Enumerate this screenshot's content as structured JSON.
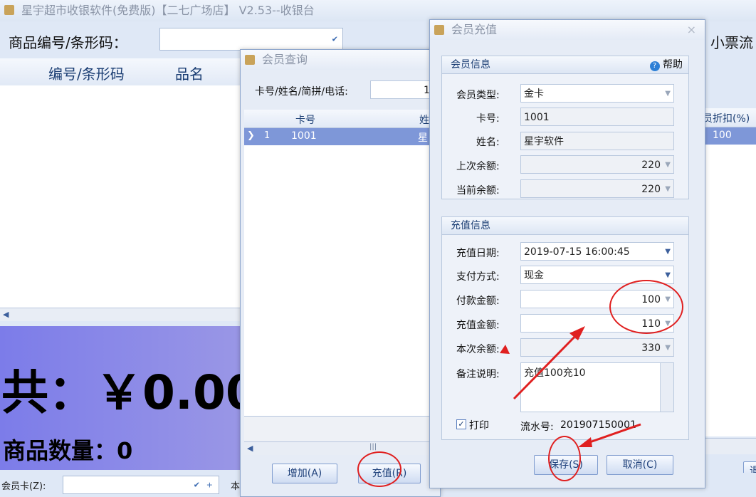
{
  "main": {
    "title": "星宇超市收银软件(免费版)【二七广场店】 V2.53--收银台",
    "barcode_label": "商品编号/条形码：",
    "receipt_label": "小票流",
    "columns": [
      "编号/条形码",
      "品名"
    ],
    "total": "共：￥0.00",
    "quantity": "商品数量：0",
    "member_card_label": "会员卡(Z):",
    "status_text": "本",
    "exit_label": "退",
    "right_column": "员折扣(%)",
    "right_value": "100"
  },
  "query_dialog": {
    "title": "会员查询",
    "search_label": "卡号/姓名/简拼/电话:",
    "search_value": "1",
    "columns": [
      "卡号",
      "姓名"
    ],
    "row_index": "1",
    "row_card": "1001",
    "row_name": "星宇",
    "add_button": "增加(A)",
    "recharge_button": "充值(R)",
    "scroll_mark": "|||"
  },
  "recharge_dialog": {
    "title": "会员充值",
    "close": "×",
    "member_group": "会员信息",
    "help": "帮助",
    "member_type_label": "会员类型:",
    "member_type": "金卡",
    "card_label": "卡号:",
    "card": "1001",
    "name_label": "姓名:",
    "name": "星宇软件",
    "prev_balance_label": "上次余额:",
    "prev_balance": "220",
    "cur_balance_label": "当前余额:",
    "cur_balance": "220",
    "recharge_group": "充值信息",
    "date_label": "充值日期:",
    "date": "2019-07-15 16:00:45",
    "pay_method_label": "支付方式:",
    "pay_method": "现金",
    "pay_amount_label": "付款金额:",
    "pay_amount": "100",
    "recharge_amount_label": "充值金额:",
    "recharge_amount": "110",
    "this_balance_label": "本次余额:",
    "this_balance": "330",
    "remark_label": "备注说明:",
    "remark": "充值100充10",
    "print_label": "打印",
    "serial_label": "流水号:",
    "serial": "201907150001",
    "save_button": "保存(S)",
    "cancel_button": "取消(C)"
  },
  "colors": {
    "annotation": "#e02020",
    "accent": "#1a3d73",
    "total_panel": "#8b89e8"
  }
}
